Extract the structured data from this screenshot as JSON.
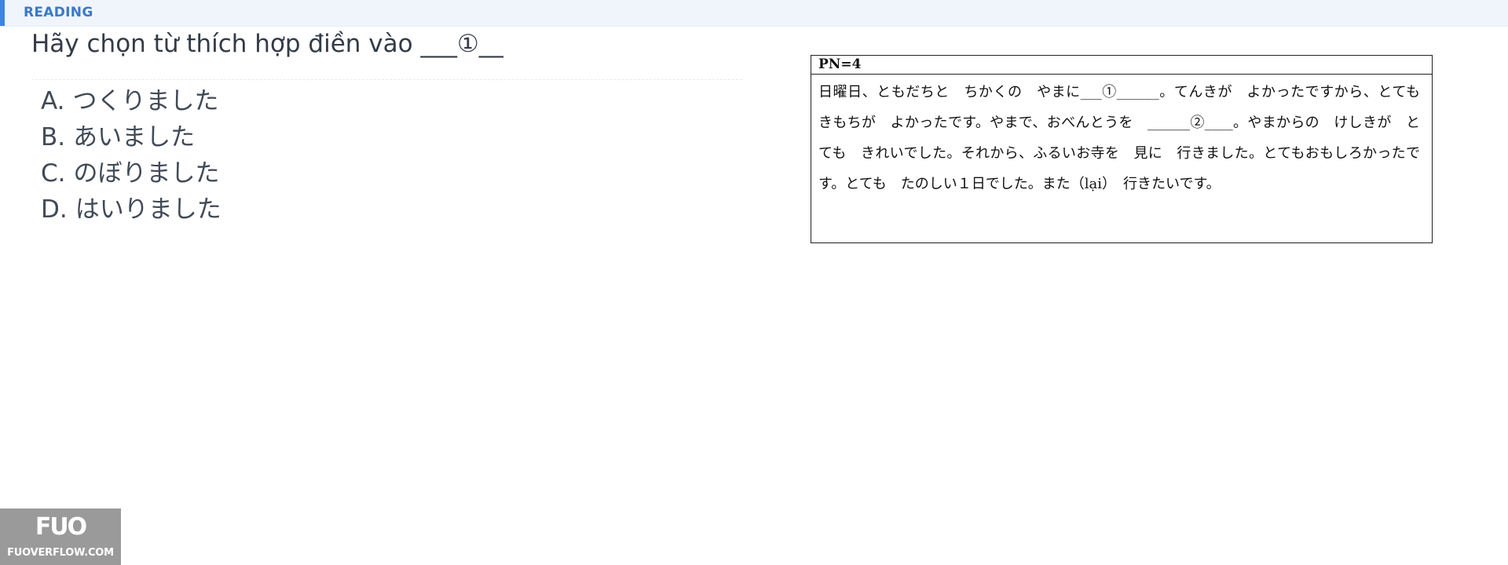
{
  "section": {
    "label": "READING"
  },
  "question": {
    "prompt": "Hãy chọn từ thích hợp điền vào ___①__"
  },
  "answers": [
    {
      "key": "A.",
      "text": "つくりました"
    },
    {
      "key": "B.",
      "text": "あいました"
    },
    {
      "key": "C.",
      "text": "のぼりました"
    },
    {
      "key": "D.",
      "text": "はいりました"
    }
  ],
  "passage": {
    "header": "PN=4",
    "text": "日曜日、ともだちと　ちかくの　やまに___①______。てんきが　よかったですから、とても　きもちが　よかったです。やまで、おべんとうを　______②____。やまからの　けしきが　とても　きれいでした。それから、ふるいお寺を　見に　行きました。とてもおもしろかったです。とても　たのしい１日でした。また（lại）　行きたいです。"
  },
  "logo": {
    "mark": "FUO",
    "text": "FUOVERFLOW.COM"
  },
  "colors": {
    "accent": "#3a86e6",
    "topbar_bg": "#f0f5fc",
    "text": "#333b47"
  }
}
